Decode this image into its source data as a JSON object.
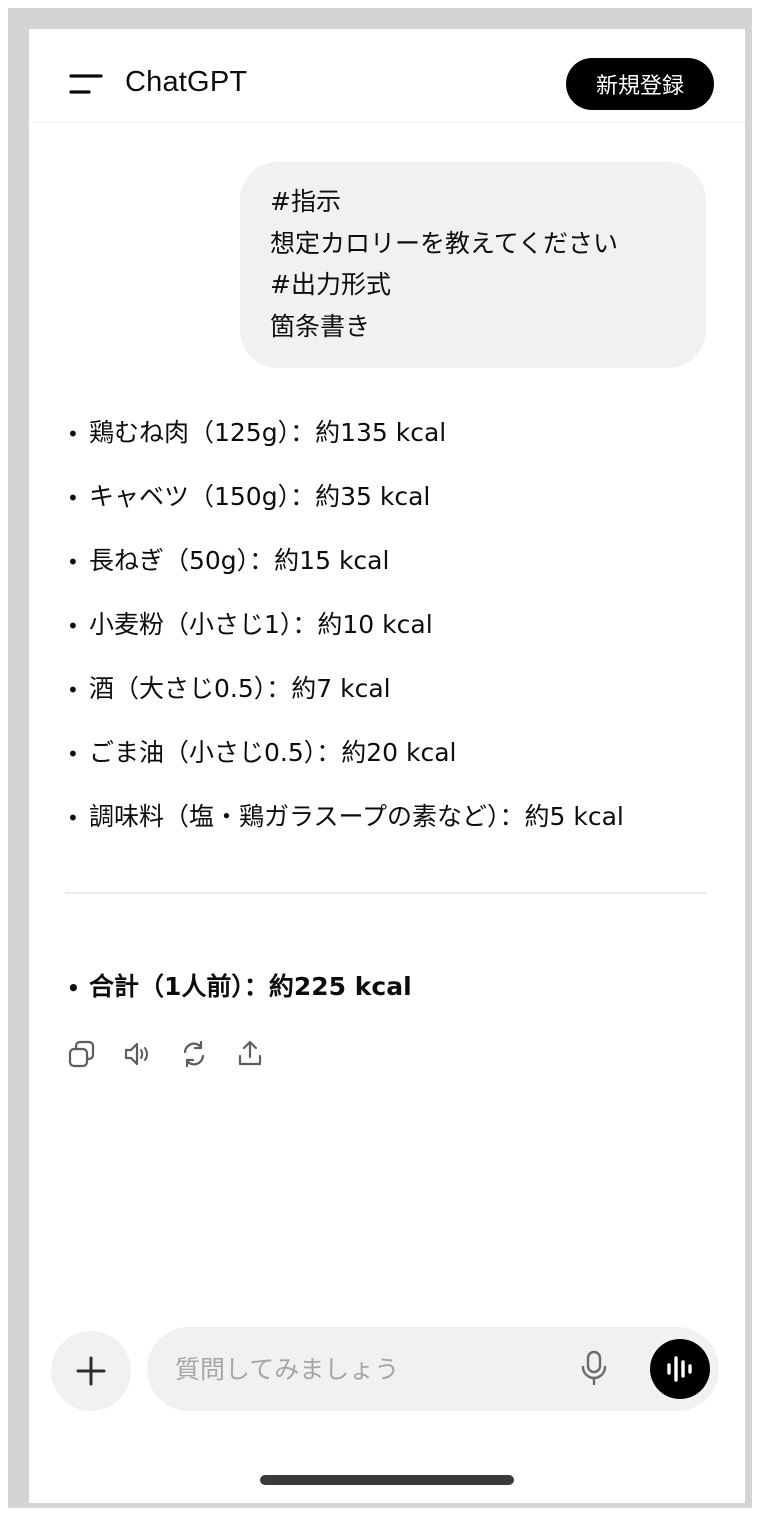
{
  "header": {
    "menu_icon": "menu-icon",
    "title": "ChatGPT",
    "signup_label": "新規登録"
  },
  "user_message": {
    "lines": [
      "#指示",
      "想定カロリーを教えてください",
      "#出力形式",
      "箇条書き"
    ]
  },
  "answer": {
    "bullet": "•",
    "items": [
      "鶏むね肉（125g）：約135 kcal",
      "キャベツ（150g）：約35 kcal",
      "長ねぎ（50g）：約15 kcal",
      "小麦粉（小さじ1）：約10 kcal",
      "酒（大さじ0.5）：約7 kcal",
      "ごま油（小さじ0.5）：約20 kcal",
      "調味料（塩・鶏ガラスープの素など）：約5 kcal"
    ],
    "total": "合計（1人前）：約225 kcal"
  },
  "actions": [
    "copy-icon",
    "speaker-icon",
    "regenerate-icon",
    "share-icon"
  ],
  "composer": {
    "placeholder": "質問してみましょう",
    "plus_icon": "plus-icon",
    "mic_icon": "microphone-icon",
    "voice_icon": "voice-mode-icon"
  },
  "colors": {
    "accent": "#000000",
    "bubble": "#f1f1f1",
    "placeholder": "#a6a6a6"
  }
}
